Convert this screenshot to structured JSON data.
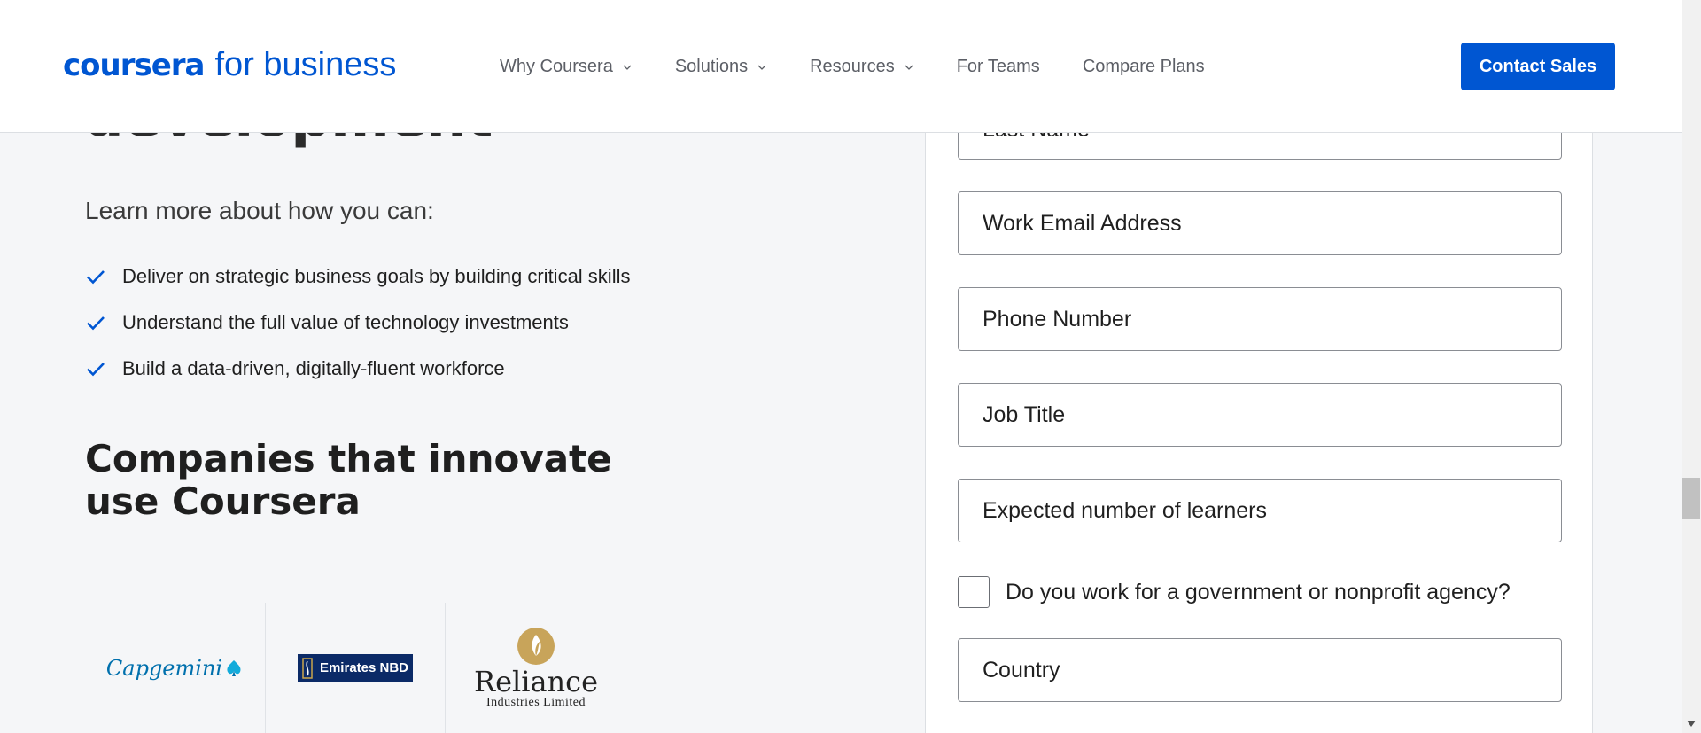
{
  "header": {
    "logo_brand": "coursera",
    "logo_suffix": "for business",
    "nav": [
      {
        "label": "Why Coursera",
        "has_dropdown": true
      },
      {
        "label": "Solutions",
        "has_dropdown": true
      },
      {
        "label": "Resources",
        "has_dropdown": true
      },
      {
        "label": "For Teams",
        "has_dropdown": false
      },
      {
        "label": "Compare Plans",
        "has_dropdown": false
      }
    ],
    "cta_label": "Contact Sales"
  },
  "hero": {
    "title_partial": "development",
    "learn_more": "Learn more about how you can:",
    "benefits": [
      "Deliver on strategic business goals by building critical skills",
      "Understand the full value of technology investments",
      "Build a data-driven, digitally-fluent workforce"
    ]
  },
  "companies": {
    "title": "Companies that innovate use Coursera",
    "logos": [
      {
        "name": "Capgemini",
        "text": "Capgemini"
      },
      {
        "name": "Emirates NBD",
        "text": "Emirates NBD"
      },
      {
        "name": "Reliance",
        "text": "Reliance",
        "subtext": "Industries Limited"
      }
    ]
  },
  "form": {
    "fields": {
      "last_name": "Last Name",
      "work_email": "Work Email Address",
      "phone": "Phone Number",
      "job_title": "Job Title",
      "learners": "Expected number of learners",
      "country": "Country"
    },
    "nonprofit_question": "Do you work for a government or nonprofit agency?",
    "nonprofit_checked": false
  },
  "colors": {
    "brand_blue": "#0056d2",
    "background": "#f5f6f8",
    "check_icon": "#0056d2"
  }
}
